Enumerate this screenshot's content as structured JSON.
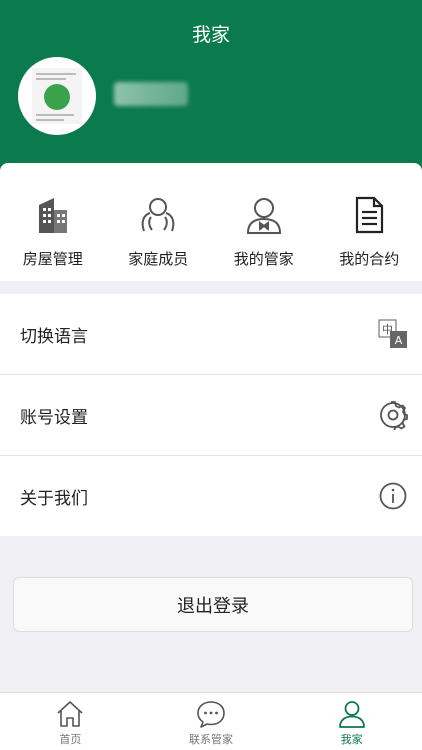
{
  "header": {
    "title": "我家"
  },
  "profile": {
    "avatar_icon": "avatar-qr-image",
    "username_icon": "blurred-username"
  },
  "quick_actions": [
    {
      "label": "房屋管理",
      "icon": "building-icon"
    },
    {
      "label": "家庭成员",
      "icon": "family-members-icon"
    },
    {
      "label": "我的管家",
      "icon": "butler-icon"
    },
    {
      "label": "我的合约",
      "icon": "contract-icon"
    }
  ],
  "menu": [
    {
      "label": "切换语言",
      "icon": "translate-icon"
    },
    {
      "label": "账号设置",
      "icon": "gear-icon"
    },
    {
      "label": "关于我们",
      "icon": "info-icon"
    }
  ],
  "logout": {
    "label": "退出登录"
  },
  "tabbar": [
    {
      "label": "首页",
      "icon": "home-icon"
    },
    {
      "label": "联系管家",
      "icon": "chat-icon"
    },
    {
      "label": "我家",
      "icon": "person-icon",
      "active": true
    }
  ],
  "colors": {
    "brand": "#0b7a4c",
    "background": "#efeff4"
  }
}
